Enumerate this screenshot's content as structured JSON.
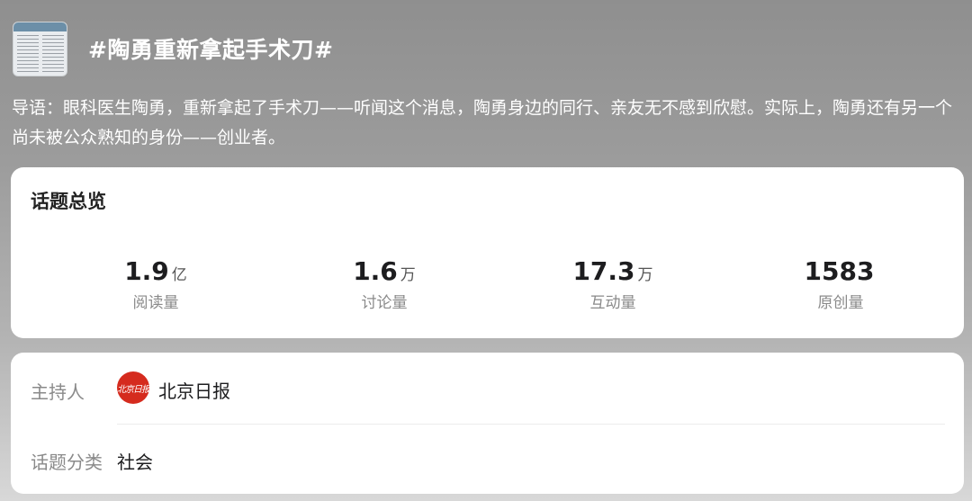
{
  "header": {
    "thumbnail_icon": "newspaper-thumbnail",
    "title": "#陶勇重新拿起手术刀#"
  },
  "intro": "导语：眼科医生陶勇，重新拿起了手术刀——听闻这个消息，陶勇身边的同行、亲友无不感到欣慰。实际上，陶勇还有另一个尚未被公众熟知的身份——创业者。",
  "overview": {
    "title": "话题总览",
    "stats": [
      {
        "value": "1.9",
        "unit": "亿",
        "label": "阅读量"
      },
      {
        "value": "1.6",
        "unit": "万",
        "label": "讨论量"
      },
      {
        "value": "17.3",
        "unit": "万",
        "label": "互动量"
      },
      {
        "value": "1583",
        "unit": "",
        "label": "原创量"
      }
    ]
  },
  "info": {
    "host_label": "主持人",
    "host_logo_text": "北京日报",
    "host_name": "北京日报",
    "category_label": "话题分类",
    "category_value": "社会"
  },
  "colors": {
    "host_logo_bg": "#d52b1e",
    "card_bg": "#ffffff",
    "label_gray": "#8a8a8a"
  }
}
